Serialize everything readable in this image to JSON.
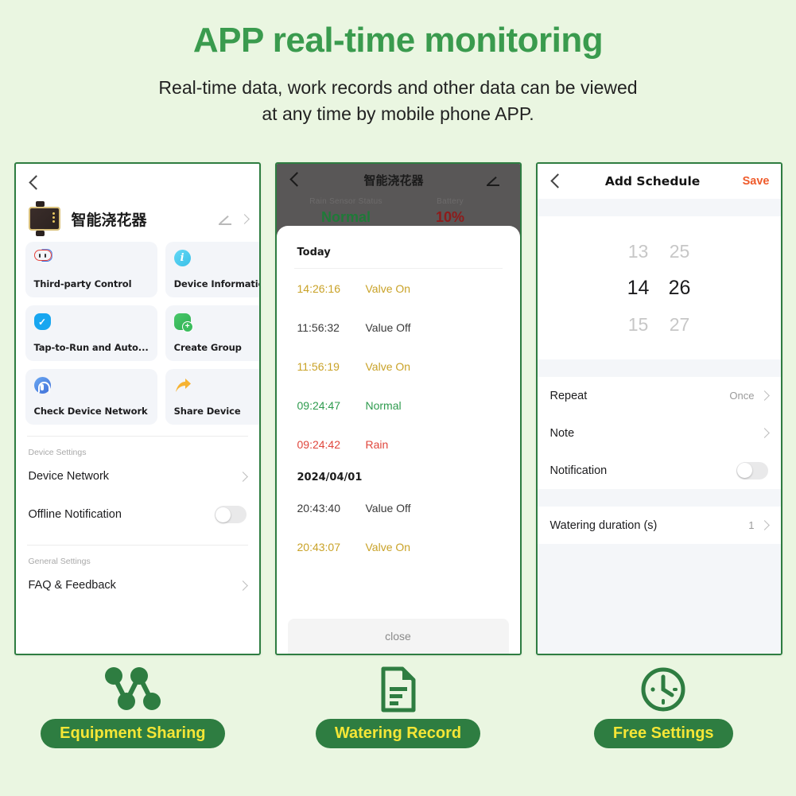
{
  "header": {
    "title": "APP real-time monitoring",
    "subtitle_line1": "Real-time data, work records and other data can be viewed",
    "subtitle_line2": "at any time by mobile phone APP."
  },
  "colors": {
    "page_bg": "#eaf6e1",
    "brand_green": "#2e7d41",
    "title_green": "#3a9b4e",
    "pill_yellow": "#f5e636",
    "save_orange": "#ef5b2b",
    "log_gold": "#c9a227",
    "log_green": "#2e9b4e",
    "log_red": "#e0463c"
  },
  "phone1": {
    "back_icon": "chevron-left-icon",
    "device": {
      "name": "智能浇花器",
      "edit_icon": "pencil-icon",
      "chevron_icon": "chevron-right-icon"
    },
    "cards": [
      {
        "label": "Third-party Control",
        "icon": "third-party-control-icon"
      },
      {
        "label": "Device Information",
        "icon": "info-icon"
      },
      {
        "label": "Tap-to-Run and Auto...",
        "icon": "check-badge-icon"
      },
      {
        "label": "Create Group",
        "icon": "create-group-icon"
      },
      {
        "label": "Check Device Network",
        "icon": "network-check-icon"
      },
      {
        "label": "Share Device",
        "icon": "share-arrow-icon"
      }
    ],
    "device_settings_title": "Device Settings",
    "device_network_label": "Device Network",
    "offline_notification_label": "Offline Notification",
    "offline_notification_state": "off",
    "general_settings_title": "General Settings",
    "faq_label": "FAQ & Feedback"
  },
  "phone2": {
    "title": "智能浇花器",
    "back_icon": "chevron-left-icon",
    "edit_icon": "pencil-icon",
    "stats": [
      {
        "caption": "Rain Sensor Status",
        "value": "Normal",
        "tone": "green"
      },
      {
        "caption": "Battery",
        "value": "10%",
        "tone": "red"
      }
    ],
    "sheet_title": "Today",
    "log_groups": [
      {
        "date": "Today",
        "entries": [
          {
            "time": "14:26:16",
            "event": "Valve On",
            "tone": "gold"
          },
          {
            "time": "11:56:32",
            "event": "Value Off",
            "tone": "gray"
          },
          {
            "time": "11:56:19",
            "event": "Valve On",
            "tone": "gold"
          },
          {
            "time": "09:24:47",
            "event": "Normal",
            "tone": "green"
          },
          {
            "time": "09:24:42",
            "event": "Rain",
            "tone": "red"
          }
        ]
      },
      {
        "date": "2024/04/01",
        "entries": [
          {
            "time": "20:43:40",
            "event": "Value Off",
            "tone": "gray"
          },
          {
            "time": "20:43:07",
            "event": "Valve On",
            "tone": "gold"
          }
        ]
      }
    ],
    "close_label": "close"
  },
  "phone3": {
    "title": "Add Schedule",
    "back_icon": "chevron-left-icon",
    "save_label": "Save",
    "picker": {
      "above": {
        "hour": "13",
        "minute": "25"
      },
      "selected": {
        "hour": "14",
        "minute": "26"
      },
      "below": {
        "hour": "15",
        "minute": "27"
      }
    },
    "rows": [
      {
        "label": "Repeat",
        "value": "Once",
        "type": "chevron"
      },
      {
        "label": "Note",
        "value": "",
        "type": "chevron"
      },
      {
        "label": "Notification",
        "value": "off",
        "type": "toggle"
      }
    ],
    "duration_row": {
      "label": "Watering duration (s)",
      "value": "1",
      "type": "chevron"
    }
  },
  "features": [
    {
      "label": "Equipment Sharing",
      "icon": "share-network-icon"
    },
    {
      "label": "Watering Record",
      "icon": "document-lines-icon"
    },
    {
      "label": "Free Settings",
      "icon": "clock-icon"
    }
  ]
}
